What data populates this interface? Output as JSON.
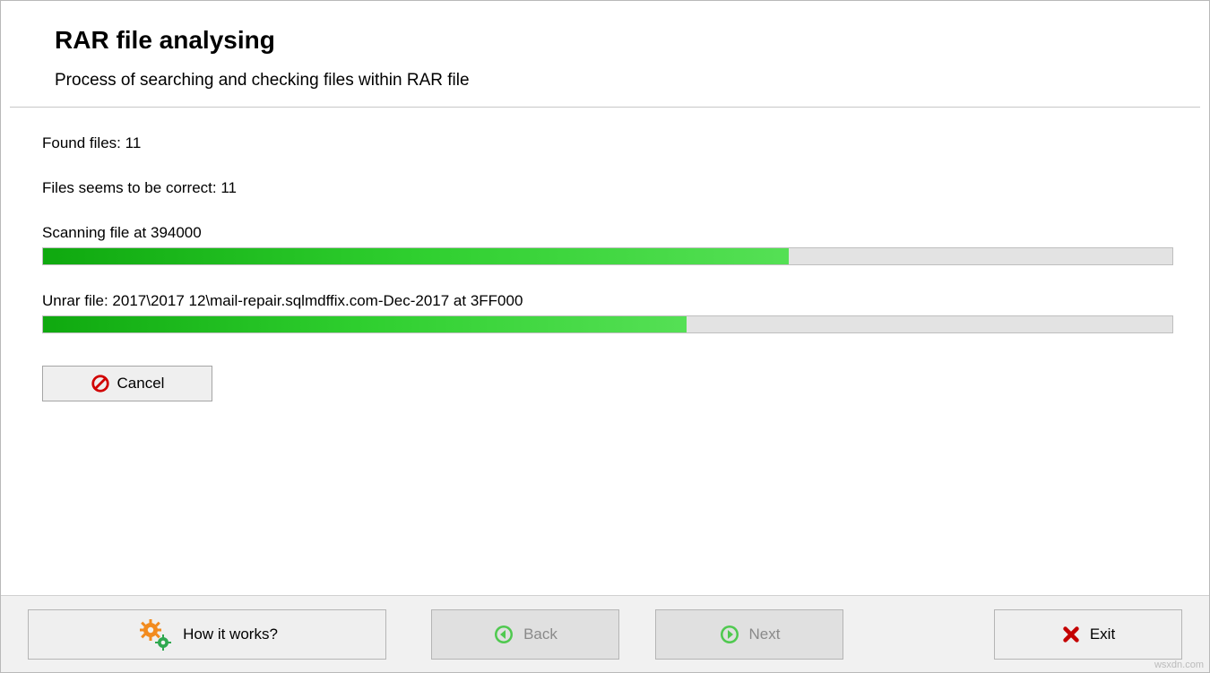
{
  "header": {
    "title": "RAR file analysing",
    "subtitle": "Process of searching and checking files within RAR file"
  },
  "status": {
    "found_label": "Found files:",
    "found_count": "11",
    "correct_label": "Files seems to be correct:",
    "correct_count": "11",
    "scan_label_prefix": "Scanning file at",
    "scan_offset": "394000",
    "scan_progress_pct": 66,
    "unrar_label_prefix": "Unrar file:",
    "unrar_path": "2017\\2017 12\\mail-repair.sqlmdffix.com-Dec-2017 at 3FF000",
    "unrar_progress_pct": 57
  },
  "buttons": {
    "cancel": "Cancel",
    "how": "How it works?",
    "back": "Back",
    "next": "Next",
    "exit": "Exit"
  },
  "watermark": "wsxdn.com"
}
